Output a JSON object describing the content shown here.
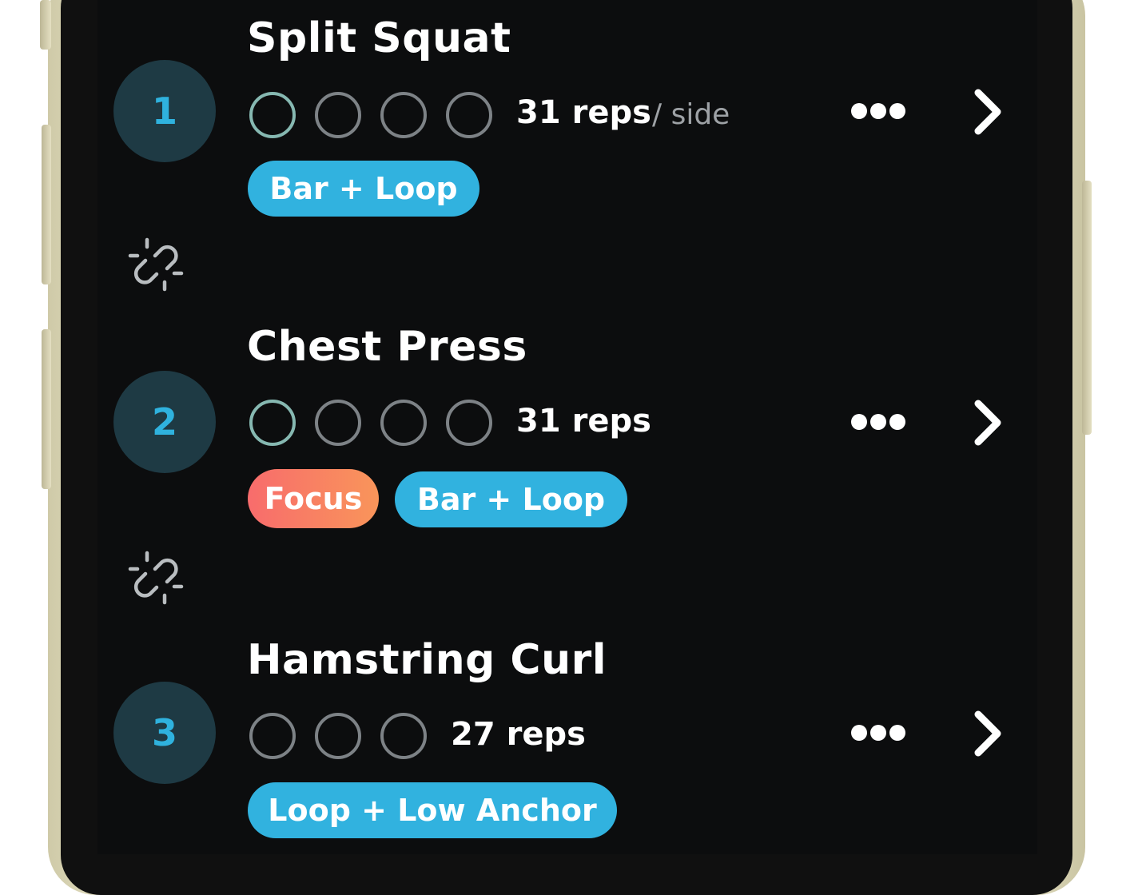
{
  "colors": {
    "accent": "#31b2df",
    "focus_start": "#f86c6c",
    "focus_end": "#f9955a",
    "number_bg": "#1e3a44",
    "screen_bg": "#0c0d0e"
  },
  "exercises": [
    {
      "number": "1",
      "title": "Split Squat",
      "reps": "31 reps",
      "per_side": "/ side",
      "set_count": 4,
      "tags": [
        "Bar + Loop"
      ],
      "more_icon": "ellipsis-icon",
      "open_icon": "chevron-right-icon"
    },
    {
      "number": "2",
      "title": "Chest Press",
      "reps": "31 reps",
      "set_count": 4,
      "tags": [
        "Focus",
        "Bar + Loop"
      ],
      "more_icon": "ellipsis-icon",
      "open_icon": "chevron-right-icon"
    },
    {
      "number": "3",
      "title": "Hamstring Curl",
      "reps": "27 reps",
      "set_count": 3,
      "tags": [
        "Loop + Low Anchor"
      ],
      "more_icon": "ellipsis-icon",
      "open_icon": "chevron-right-icon"
    }
  ],
  "superset_links": [
    {
      "icon": "unlink-icon"
    },
    {
      "icon": "unlink-icon"
    }
  ]
}
